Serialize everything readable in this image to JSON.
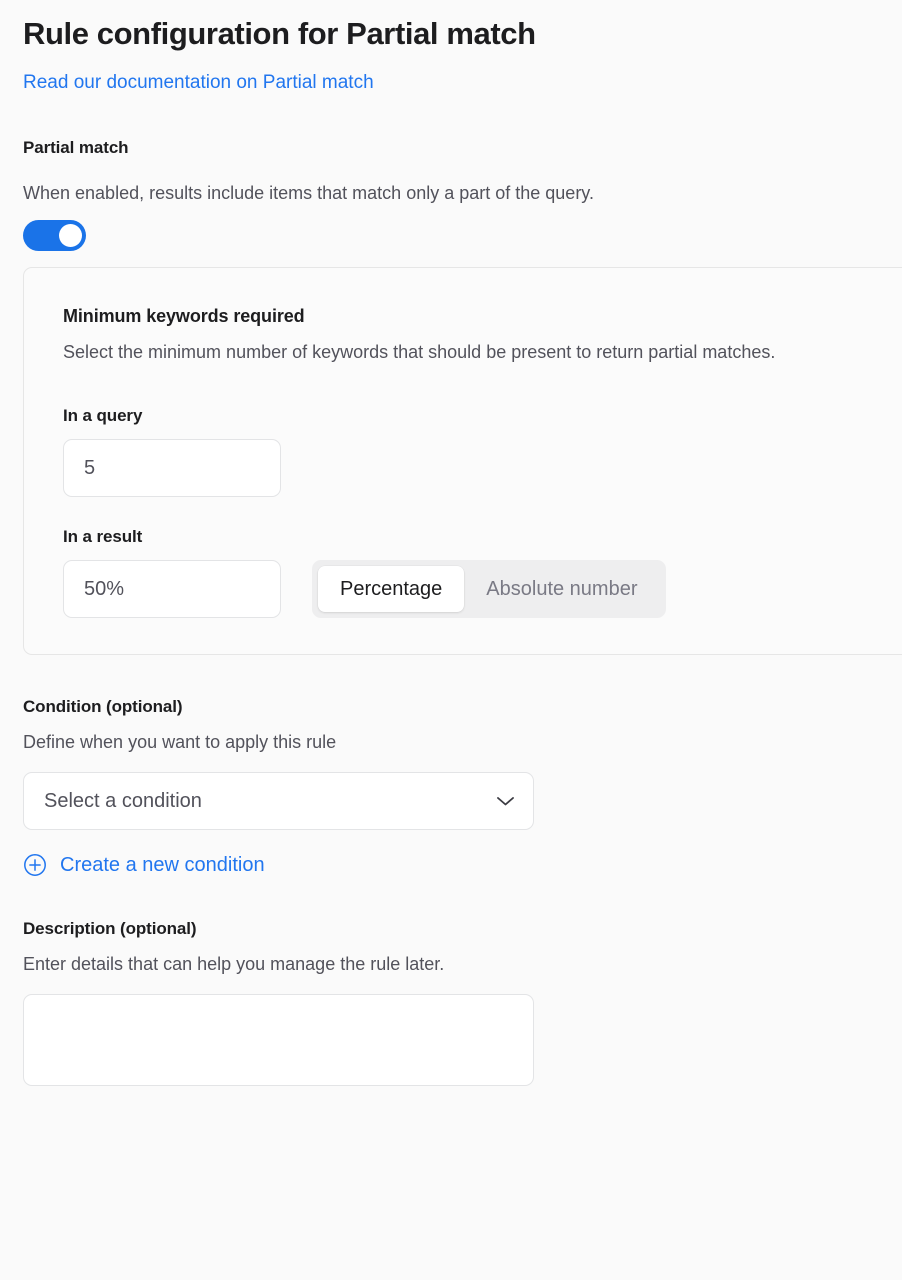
{
  "header": {
    "title": "Rule configuration for Partial match",
    "doc_link_label": "Read our documentation on Partial match"
  },
  "partial_match": {
    "heading": "Partial match",
    "description": "When enabled, results include items that match only a part of the query.",
    "toggle_enabled": "on",
    "toggle_icon": "toggle-switch-on"
  },
  "panel": {
    "title": "Minimum keywords required",
    "description": "Select the minimum number of keywords that should be present to return partial matches.",
    "query_field": {
      "label": "In a query",
      "value": "5",
      "increment_icon": "chevron-up-icon",
      "decrement_icon": "chevron-down-icon"
    },
    "result_field": {
      "label": "In a result",
      "value": "50%",
      "increment_icon": "chevron-up-icon",
      "decrement_icon": "chevron-down-icon",
      "segmented": {
        "options": [
          "Percentage",
          "Absolute number"
        ],
        "selected": "Percentage"
      }
    }
  },
  "condition": {
    "heading": "Condition (optional)",
    "description": "Define when you want to apply this rule",
    "select_placeholder": "Select a condition",
    "select_caret_icon": "chevron-down-icon",
    "create_link_label": "Create a new condition",
    "create_link_icon": "plus-circle-icon"
  },
  "description": {
    "heading": "Description (optional)",
    "helper": "Enter details that can help you manage the rule later.",
    "value": "",
    "placeholder": ""
  },
  "colors": {
    "accent_blue": "#2176ef",
    "toggle_on": "#1a73e8",
    "page_background": "#fafafa",
    "border": "#e3e4e6",
    "text_primary": "#1d1d1f",
    "text_secondary": "#52525b"
  }
}
